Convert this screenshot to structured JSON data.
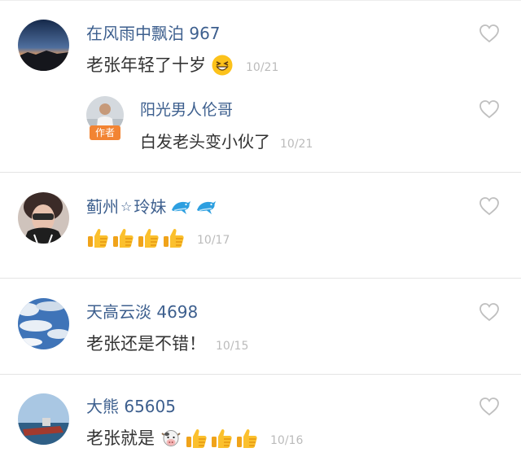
{
  "comments": [
    {
      "username": "在风雨中飘泊 967",
      "text": "老张年轻了十岁",
      "emoji": "grinning-squint-emoji",
      "date": "10/21",
      "reply": {
        "username": "阳光男人伦哥",
        "badge": "作者",
        "text": "白发老头变小伙了",
        "date": "10/21"
      }
    },
    {
      "username": "蓟州",
      "username_star": "☆",
      "username_suffix": "玲妹",
      "name_emojis": [
        "dolphin-emoji",
        "dolphin-emoji"
      ],
      "text_emojis": [
        "thumbs-up-emoji",
        "thumbs-up-emoji",
        "thumbs-up-emoji",
        "thumbs-up-emoji"
      ],
      "date": "10/17"
    },
    {
      "username": "天高云淡 4698",
      "text": "老张还是不错！",
      "date": "10/15"
    },
    {
      "username": "大熊 65605",
      "text": "老张就是",
      "text_emojis": [
        "cow-face-emoji",
        "thumbs-up-emoji",
        "thumbs-up-emoji",
        "thumbs-up-emoji"
      ],
      "date": "10/16"
    }
  ],
  "colors": {
    "username": "#3d5f8e",
    "comment_text": "#333333",
    "date": "#bbbbbb",
    "badge": "#f28433",
    "divider": "#e4e4e4",
    "heart_outline": "#bfbfbf"
  },
  "icons": {
    "like": "heart-outline-icon"
  }
}
